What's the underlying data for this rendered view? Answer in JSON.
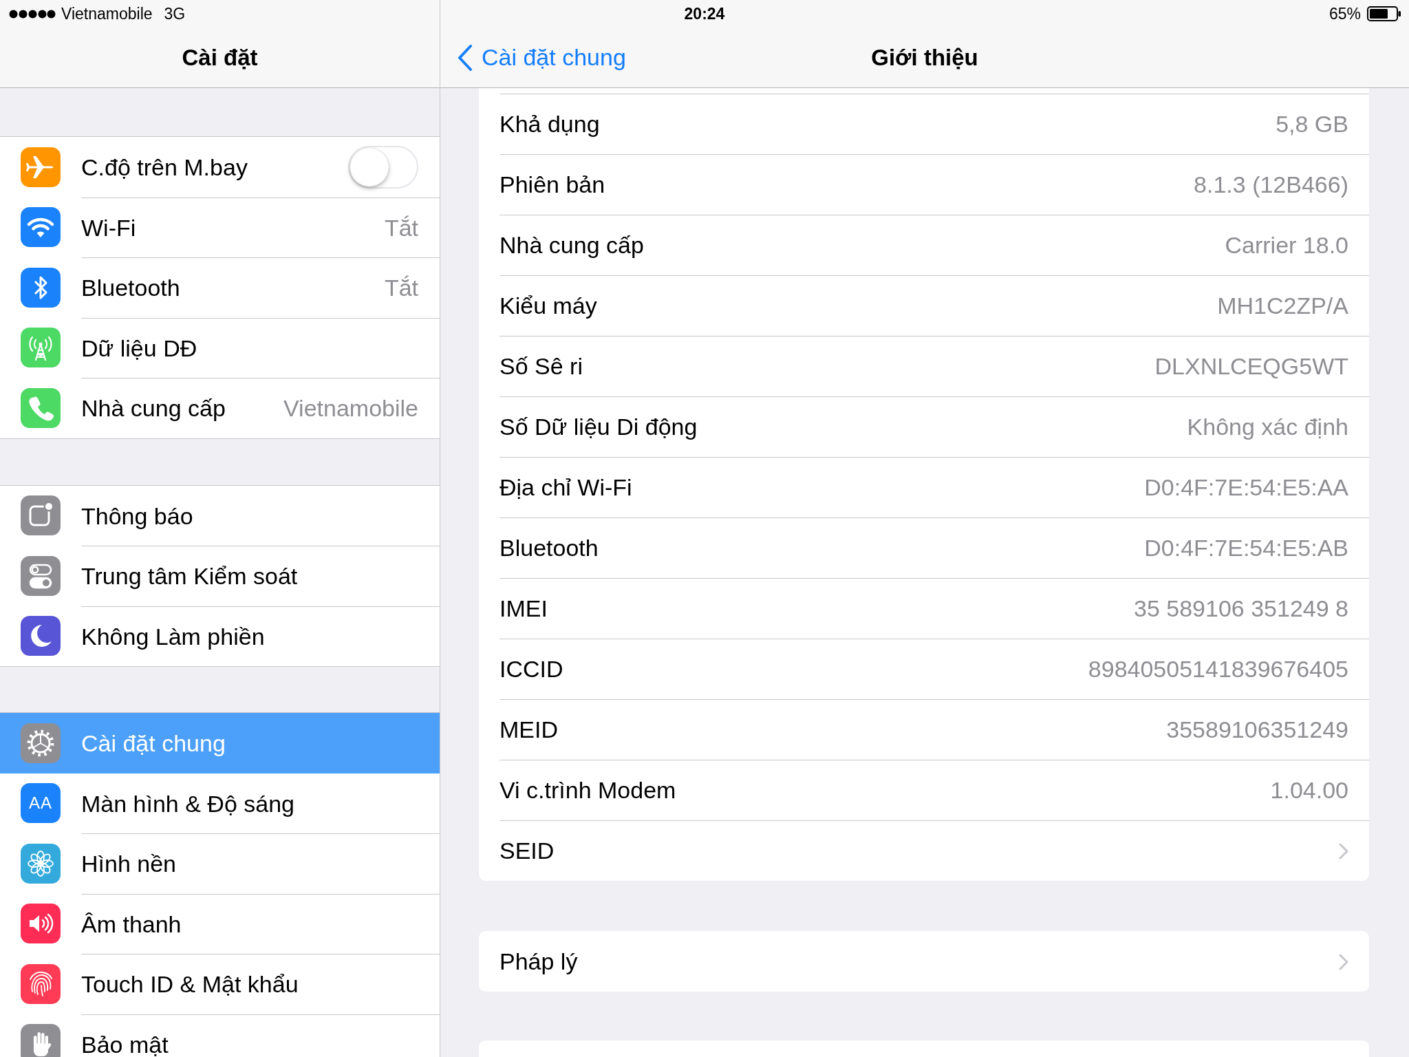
{
  "status_bar": {
    "carrier": "Vietnamobile",
    "network": "3G",
    "time": "20:24",
    "battery": "65%"
  },
  "sidebar": {
    "title": "Cài đặt",
    "groups": [
      {
        "items": [
          {
            "kind": "switch",
            "label": "C.độ trên M.bay",
            "on": false,
            "selected": false
          },
          {
            "kind": "link",
            "label": "Wi-Fi",
            "value": "Tắt",
            "selected": false
          },
          {
            "kind": "link",
            "label": "Bluetooth",
            "value": "Tắt",
            "selected": false
          },
          {
            "kind": "link",
            "label": "Dữ liệu DĐ",
            "selected": false
          },
          {
            "kind": "link",
            "label": "Nhà cung cấp",
            "value": "Vietnamobile",
            "selected": false
          }
        ]
      },
      {
        "items": [
          {
            "kind": "link",
            "label": "Thông báo",
            "selected": false
          },
          {
            "kind": "link",
            "label": "Trung tâm Kiểm soát",
            "selected": false
          },
          {
            "kind": "link",
            "label": "Không Làm phiền",
            "selected": false
          }
        ]
      },
      {
        "items": [
          {
            "kind": "link",
            "label": "Cài đặt chung",
            "selected": true
          },
          {
            "kind": "link",
            "label": "Màn hình & Độ sáng",
            "icon_glyph": "AA",
            "selected": false
          },
          {
            "kind": "link",
            "label": "Hình nền",
            "selected": false
          },
          {
            "kind": "link",
            "label": "Âm thanh",
            "selected": false
          },
          {
            "kind": "link",
            "label": "Touch ID & Mật khẩu",
            "selected": false
          },
          {
            "kind": "link",
            "label": "Bảo mật",
            "selected": false
          }
        ]
      }
    ]
  },
  "detail": {
    "back": "Cài đặt chung",
    "title": "Giới thiệu",
    "groups": [
      {
        "rows": [
          {
            "kind": "info",
            "label": "Khả dụng",
            "value": "5,8 GB"
          },
          {
            "kind": "info",
            "label": "Phiên bản",
            "value": "8.1.3 (12B466)"
          },
          {
            "kind": "info",
            "label": "Nhà cung cấp",
            "value": "Carrier 18.0"
          },
          {
            "kind": "info",
            "label": "Kiểu máy",
            "value": "MH1C2ZP/A"
          },
          {
            "kind": "info",
            "label": "Số Sê ri",
            "value": "DLXNLCEQG5WT"
          },
          {
            "kind": "info",
            "label": "Số Dữ liệu Di động",
            "value": "Không xác định"
          },
          {
            "kind": "info",
            "label": "Địa chỉ Wi-Fi",
            "value": "D0:4F:7E:54:E5:AA"
          },
          {
            "kind": "info",
            "label": "Bluetooth",
            "value": "D0:4F:7E:54:E5:AB"
          },
          {
            "kind": "info",
            "label": "IMEI",
            "value": "35 589106 351249 8"
          },
          {
            "kind": "info",
            "label": "ICCID",
            "value": "89840505141839676405"
          },
          {
            "kind": "info",
            "label": "MEID",
            "value": "35589106351249"
          },
          {
            "kind": "info",
            "label": "Vi c.trình Modem",
            "value": "1.04.00"
          },
          {
            "kind": "link",
            "label": "SEID"
          }
        ]
      },
      {
        "rows": [
          {
            "kind": "link",
            "label": "Pháp lý"
          }
        ]
      }
    ]
  }
}
